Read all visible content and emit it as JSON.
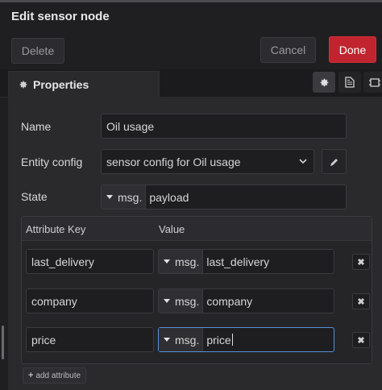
{
  "dialog": {
    "title": "Edit sensor node",
    "delete_label": "Delete",
    "cancel_label": "Cancel",
    "done_label": "Done",
    "done_color": "#c0252f"
  },
  "tabs": {
    "properties_label": "Properties",
    "icons": [
      "gear-icon",
      "description-icon",
      "appearance-icon"
    ]
  },
  "form": {
    "name_label": "Name",
    "name_value": "Oil usage",
    "entity_config_label": "Entity config",
    "entity_config_value": "sensor config for Oil usage",
    "state_label": "State",
    "state_type": "msg.",
    "state_value": "payload"
  },
  "attributes": {
    "key_header": "Attribute Key",
    "value_header": "Value",
    "rows": [
      {
        "key": "last_delivery",
        "type": "msg.",
        "value": "last_delivery"
      },
      {
        "key": "company",
        "type": "msg.",
        "value": "company"
      },
      {
        "key": "price",
        "type": "msg.",
        "value": "price"
      }
    ],
    "add_label": "add attribute"
  }
}
